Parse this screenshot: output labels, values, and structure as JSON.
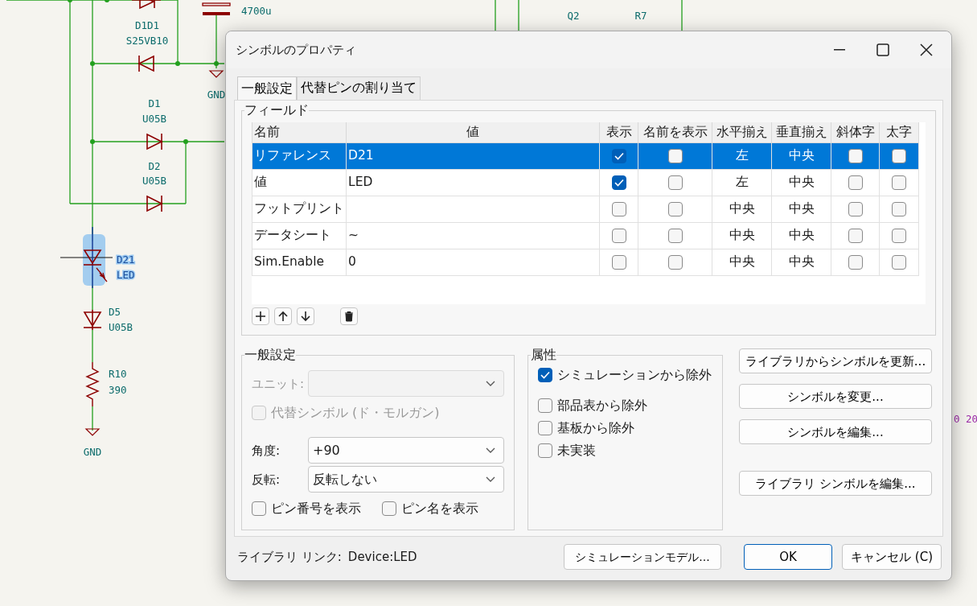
{
  "schematic": {
    "labels": [
      {
        "text": "4700u",
        "selected": false
      },
      {
        "text": "D1D1",
        "selected": false
      },
      {
        "text": "S25VB10",
        "selected": false
      },
      {
        "text": "GND",
        "selected": false
      },
      {
        "text": "D1",
        "selected": false
      },
      {
        "text": "U05B",
        "selected": false
      },
      {
        "text": "D2",
        "selected": false
      },
      {
        "text": "U05B",
        "selected": false
      },
      {
        "text": "Q2",
        "selected": false
      },
      {
        "text": "R7",
        "selected": false
      },
      {
        "text": "D21",
        "selected": true
      },
      {
        "text": "LED",
        "selected": true
      },
      {
        "text": "D5",
        "selected": false
      },
      {
        "text": "U05B",
        "selected": false
      },
      {
        "text": "R10",
        "selected": false
      },
      {
        "text": "390",
        "selected": false
      },
      {
        "text": "GND",
        "selected": false
      },
      {
        "text": "0 20",
        "selected": false
      }
    ]
  },
  "window": {
    "title": "シンボルのプロパティ"
  },
  "tabs": [
    {
      "label": "一般設定",
      "selected": true
    },
    {
      "label": "代替ピンの割り当て",
      "selected": false
    }
  ],
  "fields": {
    "title": "フィールド",
    "columns": [
      "名前",
      "値",
      "表示",
      "名前を表示",
      "水平揃え",
      "垂直揃え",
      "斜体字",
      "太字"
    ],
    "rows": [
      {
        "name": "リファレンス",
        "value": "D21",
        "show": true,
        "show_name": false,
        "h_align": "左",
        "v_align": "中央",
        "italic": false,
        "bold": false,
        "selected": true
      },
      {
        "name": "値",
        "value": "LED",
        "show": true,
        "show_name": false,
        "h_align": "左",
        "v_align": "中央",
        "italic": false,
        "bold": false,
        "selected": false
      },
      {
        "name": "フットプリント",
        "value": "",
        "show": false,
        "show_name": false,
        "h_align": "中央",
        "v_align": "中央",
        "italic": false,
        "bold": false,
        "selected": false
      },
      {
        "name": "データシート",
        "value": "~",
        "show": false,
        "show_name": false,
        "h_align": "中央",
        "v_align": "中央",
        "italic": false,
        "bold": false,
        "selected": false
      },
      {
        "name": "Sim.Enable",
        "value": "0",
        "show": false,
        "show_name": false,
        "h_align": "中央",
        "v_align": "中央",
        "italic": false,
        "bold": false,
        "selected": false
      }
    ]
  },
  "general": {
    "title": "一般設定",
    "unit": {
      "label": "ユニット:",
      "disabled": true
    },
    "alternate": {
      "label": "代替シンボル (ド・モルガン)",
      "checked": false,
      "disabled": true
    },
    "angle": {
      "label": "角度:",
      "value": "+90"
    },
    "mirror": {
      "label": "反転:",
      "value": "反転しない"
    },
    "pin_checks": [
      {
        "label": "ピン番号を表示",
        "checked": false
      },
      {
        "label": "ピン名を表示",
        "checked": false
      }
    ]
  },
  "attributes": {
    "title": "属性",
    "checks": [
      {
        "label": "シミュレーションから除外",
        "checked": true
      },
      {
        "label": "部品表から除外",
        "checked": false
      },
      {
        "label": "基板から除外",
        "checked": false
      },
      {
        "label": "未実装",
        "checked": false
      }
    ]
  },
  "side_buttons": [
    "ライブラリからシンボルを更新...",
    "シンボルを変更...",
    "シンボルを編集...",
    "ライブラリ シンボルを編集..."
  ],
  "footer": {
    "library_label": "ライブラリ リンク:",
    "library_value": "Device:LED",
    "buttons": [
      {
        "label": "シミュレーションモデル...",
        "kind": "normal"
      },
      {
        "label": "OK",
        "kind": "default"
      },
      {
        "label": "キャンセル (C)",
        "kind": "normal"
      }
    ]
  }
}
